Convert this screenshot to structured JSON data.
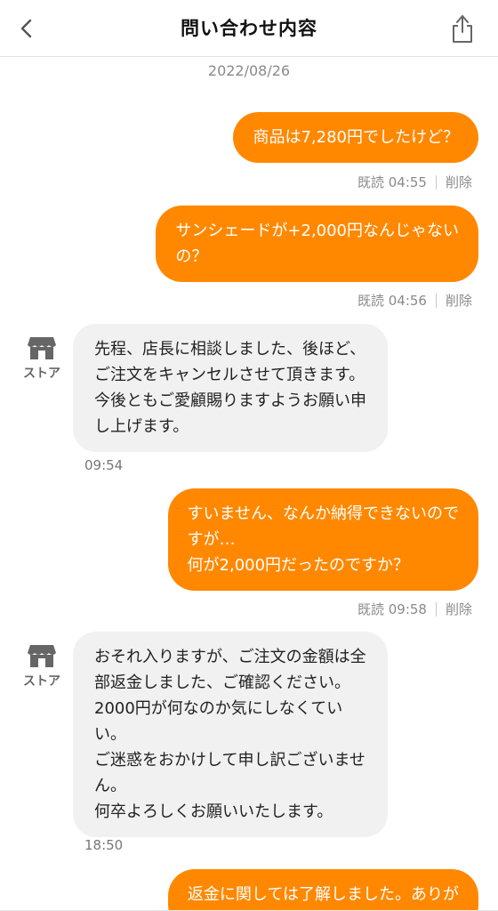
{
  "header": {
    "title": "問い合わせ内容",
    "back_icon": "chevron-left-icon",
    "share_icon": "share-icon"
  },
  "date": "2022/08/26",
  "colors": {
    "outgoing_bubble": "#ff8800",
    "incoming_bubble": "#f1f1f1",
    "meta_text": "#8a8a8a"
  },
  "store_label": "ストア",
  "messages": [
    {
      "text": "商品は7,280円でしたけど？",
      "read_label": "既読 04:55",
      "delete_label": "削除"
    },
    {
      "text": "サンシェードが+2,000円なんじゃない\nの？",
      "read_label": "既読 04:56",
      "delete_label": "削除"
    },
    {
      "text": "先程、店長に相談しました、後ほど、\nご注文をキャンセルさせて頂きます。\n今後ともご愛顧賜りますようお願い申\nし上げます。",
      "time": "09:54"
    },
    {
      "text": "すいません、なんか納得できないので\nすが…\n何が2,000円だったのですか？",
      "read_label": "既読 09:58",
      "delete_label": "削除"
    },
    {
      "text": "おそれ入りますが、ご注文の金額は全\n部返金しました、ご確認ください。\n2000円が何なのか気にしなくてい\nい。\nご迷惑をおかけして申し訳ございませ\nん。\n何卒よろしくお願いいたします。",
      "time": "18:50"
    },
    {
      "text": "返金に関しては了解しました。ありが"
    }
  ]
}
